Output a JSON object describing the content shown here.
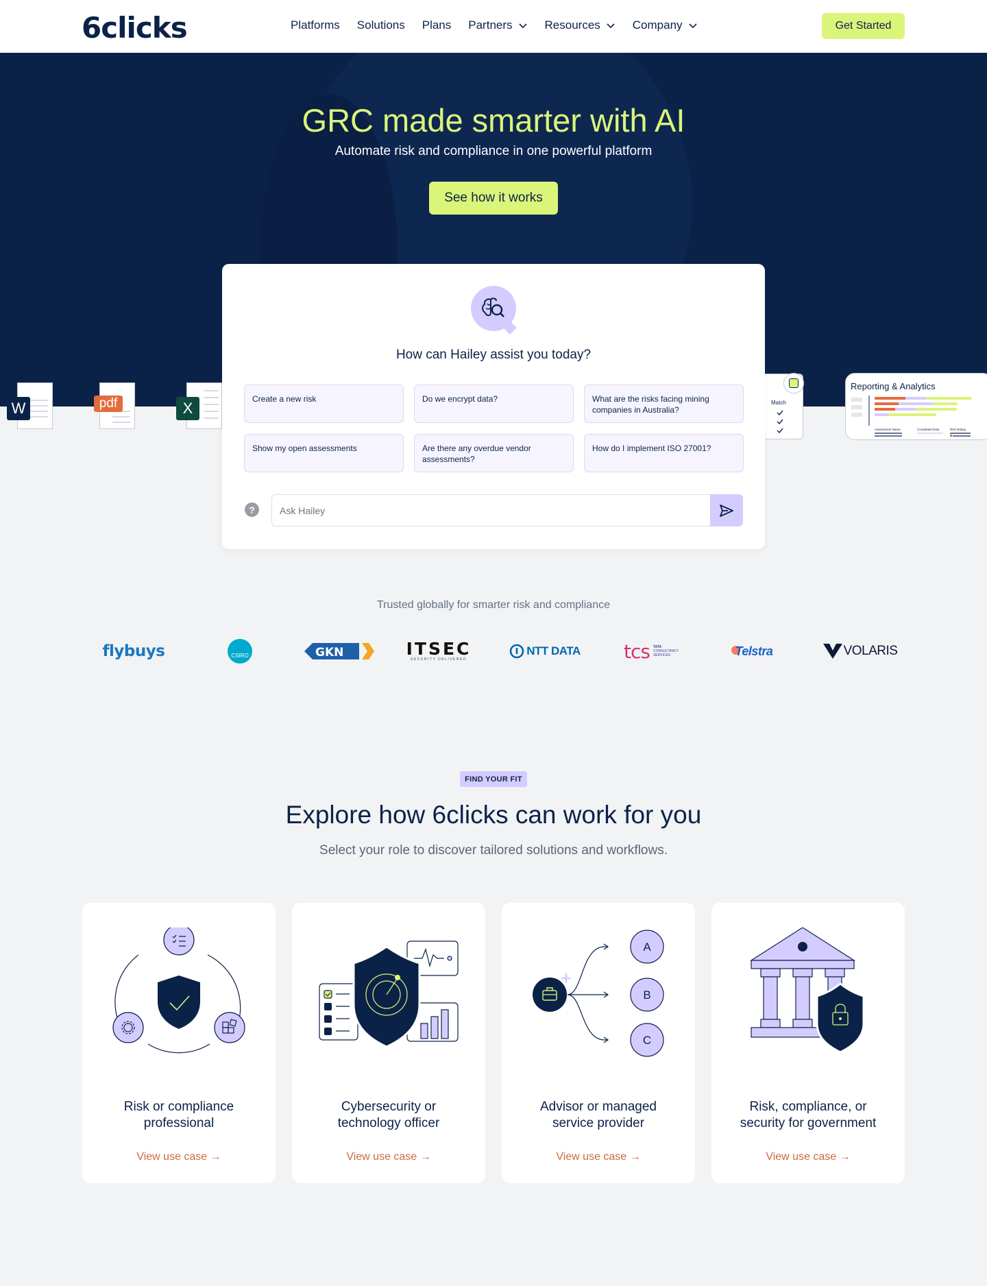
{
  "nav": {
    "logo": "6clicks",
    "links": [
      {
        "label": "Platforms"
      },
      {
        "label": "Solutions"
      },
      {
        "label": "Plans"
      },
      {
        "label": "Partners"
      },
      {
        "label": "Resources"
      },
      {
        "label": "Company"
      }
    ],
    "cta": "Get Started"
  },
  "hero": {
    "title": "GRC made smarter with AI",
    "subtitle": "Automate risk and compliance in one powerful platform",
    "button": "See how it works",
    "word_label": "W",
    "pdf_label": "pdf",
    "excel_label": "X",
    "match_label": "Match",
    "reporting_title": "Reporting & Analytics",
    "reporting_cols": [
      "Assessment Name",
      "Completed Date",
      "Risk Rating"
    ]
  },
  "chat": {
    "question": "How can Hailey assist you today?",
    "suggestions": [
      "Create a new risk",
      "Do we encrypt data?",
      "What are the risks facing mining companies in Australia?",
      "Show my open assessments",
      "Are there any overdue vendor assessments?",
      "How do I implement ISO 27001?"
    ],
    "help": "?",
    "input_placeholder": "Ask Hailey"
  },
  "trusted": {
    "text": "Trusted globally for smarter risk and compliance",
    "logos": [
      "flybuys",
      "CSIRO",
      "GKN",
      "ITSEC",
      "NTT DATA",
      "tcs",
      "Telstra",
      "VOLARIS"
    ],
    "itsec_tag": "SECURITY DELIVERED",
    "tcs_tag": [
      "TATA",
      "CONSULTANCY",
      "SERVICES"
    ]
  },
  "fit": {
    "badge": "FIND YOUR FIT",
    "title": "Explore how 6clicks can work for you",
    "subtitle": "Select your role to discover tailored solutions and workflows.",
    "cards": [
      {
        "title_line1": "Risk or compliance",
        "title_line2": "professional",
        "link": "View use case →"
      },
      {
        "title_line1": "Cybersecurity or",
        "title_line2": "technology officer",
        "link": "View use case →"
      },
      {
        "title_line1": "Advisor or managed",
        "title_line2": "service provider",
        "link": "View use case →",
        "options": [
          "A",
          "B",
          "C"
        ]
      },
      {
        "title_line1": "Risk, compliance, or",
        "title_line2": "security for government",
        "link": "View use case →"
      }
    ]
  },
  "colors": {
    "navy": "#0b2248",
    "lime": "#dbf47a",
    "lavender": "#d4ccff",
    "orange": "#d0683e",
    "background": "#f2f3f5"
  }
}
